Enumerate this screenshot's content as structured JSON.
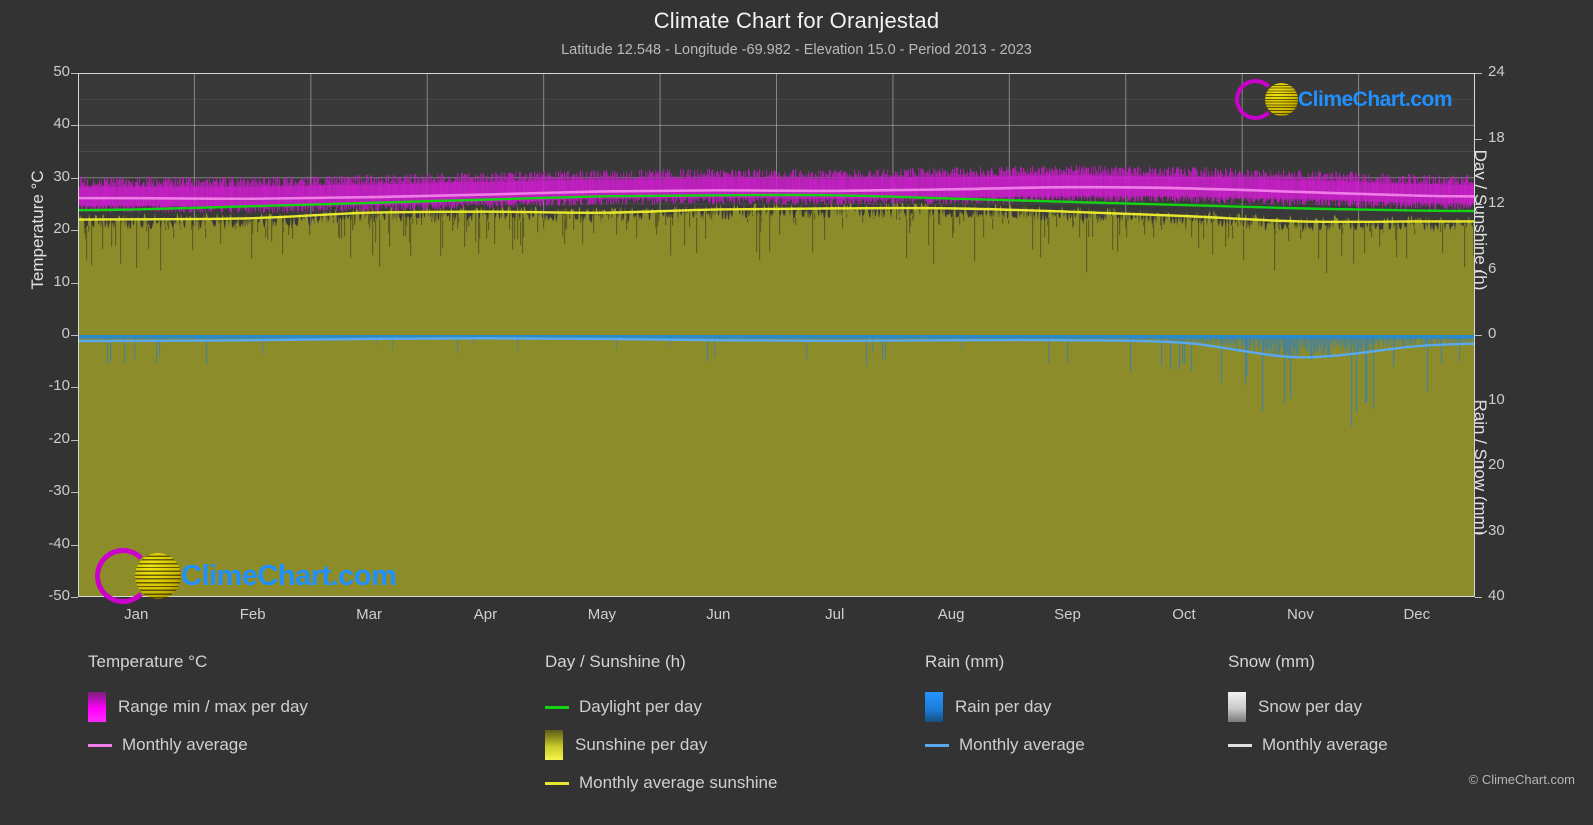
{
  "header": {
    "title": "Climate Chart for Oranjestad",
    "subtitle": "Latitude 12.548 - Longitude -69.982 - Elevation 15.0 - Period 2013 - 2023"
  },
  "branding": {
    "logo_text": "ClimeChart.com",
    "copyright": "© ClimeChart.com",
    "logo_blue": "#1e90ff",
    "logo_magenta": "#cc00cc",
    "logo_yellow": "#e8e000"
  },
  "axes": {
    "left_label": "Temperature °C",
    "left_ticks": [
      "50",
      "40",
      "30",
      "20",
      "10",
      "0",
      "-10",
      "-20",
      "-30",
      "-40",
      "-50"
    ],
    "right_top_label": "Day / Sunshine (h)",
    "right_top_ticks": [
      "24",
      "18",
      "12",
      "6",
      "0"
    ],
    "right_bottom_label": "Rain / Snow (mm)",
    "right_bottom_ticks": [
      "0",
      "10",
      "20",
      "30",
      "40"
    ],
    "x_ticks": [
      "Jan",
      "Feb",
      "Mar",
      "Apr",
      "May",
      "Jun",
      "Jul",
      "Aug",
      "Sep",
      "Oct",
      "Nov",
      "Dec"
    ]
  },
  "legend": {
    "columns": [
      {
        "title": "Temperature °C",
        "items": [
          {
            "label": "Range min / max per day",
            "style": "swatch",
            "color": "#ff00ff"
          },
          {
            "label": "Monthly average",
            "style": "line",
            "color": "#f07ce8"
          }
        ]
      },
      {
        "title": "Day / Sunshine (h)",
        "items": [
          {
            "label": "Daylight per day",
            "style": "line",
            "color": "#13d313"
          },
          {
            "label": "Sunshine per day",
            "style": "swatch",
            "color": "#efef3a"
          },
          {
            "label": "Monthly average sunshine",
            "style": "line",
            "color": "#e8e82e"
          }
        ]
      },
      {
        "title": "Rain (mm)",
        "items": [
          {
            "label": "Rain per day",
            "style": "swatch",
            "color": "#1e90ff"
          },
          {
            "label": "Monthly average",
            "style": "line",
            "color": "#5aa9f0"
          }
        ]
      },
      {
        "title": "Snow (mm)",
        "items": [
          {
            "label": "Snow per day",
            "style": "swatch",
            "color": "#e8e8e8"
          },
          {
            "label": "Monthly average",
            "style": "line",
            "color": "#e0e0e0"
          }
        ]
      }
    ]
  },
  "chart_data": {
    "type": "area",
    "title": "Climate Chart for Oranjestad",
    "subtitle": "Latitude 12.548 - Longitude -69.982 - Elevation 15.0 - Period 2013 - 2023",
    "xlabel": "",
    "ylabel": "Temperature °C",
    "ylim": [
      -50,
      50
    ],
    "y2_top_label": "Day / Sunshine (h)",
    "y2_top_lim": [
      0,
      24
    ],
    "y2_bottom_label": "Rain / Snow (mm)",
    "y2_bottom_lim": [
      0,
      40
    ],
    "grid": true,
    "legend_position": "below",
    "categories": [
      "Jan",
      "Feb",
      "Mar",
      "Apr",
      "May",
      "Jun",
      "Jul",
      "Aug",
      "Sep",
      "Oct",
      "Nov",
      "Dec"
    ],
    "series": [
      {
        "name": "Monthly average temperature",
        "unit": "°C",
        "color": "#f07ce8",
        "values": [
          26.1,
          26.0,
          26.3,
          26.8,
          27.4,
          27.6,
          27.5,
          27.8,
          28.2,
          28.0,
          27.3,
          26.6
        ]
      },
      {
        "name": "Range max per day",
        "unit": "°C",
        "color": "#ff00ff",
        "values": [
          29.2,
          29.2,
          29.6,
          30.1,
          30.5,
          30.7,
          30.6,
          31.0,
          31.4,
          31.1,
          30.4,
          29.7
        ]
      },
      {
        "name": "Range min per day",
        "unit": "°C",
        "color": "#ff00ff",
        "values": [
          24.2,
          24.1,
          24.4,
          25.0,
          25.6,
          25.8,
          25.6,
          25.8,
          26.1,
          26.0,
          25.5,
          24.8
        ]
      },
      {
        "name": "Daylight per day",
        "unit": "h",
        "color": "#13d313",
        "values": [
          11.5,
          11.8,
          12.1,
          12.4,
          12.7,
          12.8,
          12.8,
          12.5,
          12.2,
          11.9,
          11.6,
          11.4
        ]
      },
      {
        "name": "Monthly average sunshine",
        "unit": "h",
        "color": "#e8e82e",
        "values": [
          10.6,
          10.7,
          11.2,
          11.3,
          11.2,
          11.5,
          11.6,
          11.6,
          11.3,
          10.9,
          10.4,
          10.4
        ]
      },
      {
        "name": "Rain monthly average",
        "unit": "mm",
        "color": "#5aa9f0",
        "values": [
          0.9,
          0.8,
          0.6,
          0.5,
          0.6,
          0.8,
          0.9,
          0.8,
          0.8,
          1.2,
          3.4,
          1.7
        ]
      },
      {
        "name": "Snow monthly average",
        "unit": "mm",
        "color": "#e0e0e0",
        "values": [
          0,
          0,
          0,
          0,
          0,
          0,
          0,
          0,
          0,
          0,
          0,
          0
        ]
      }
    ]
  }
}
